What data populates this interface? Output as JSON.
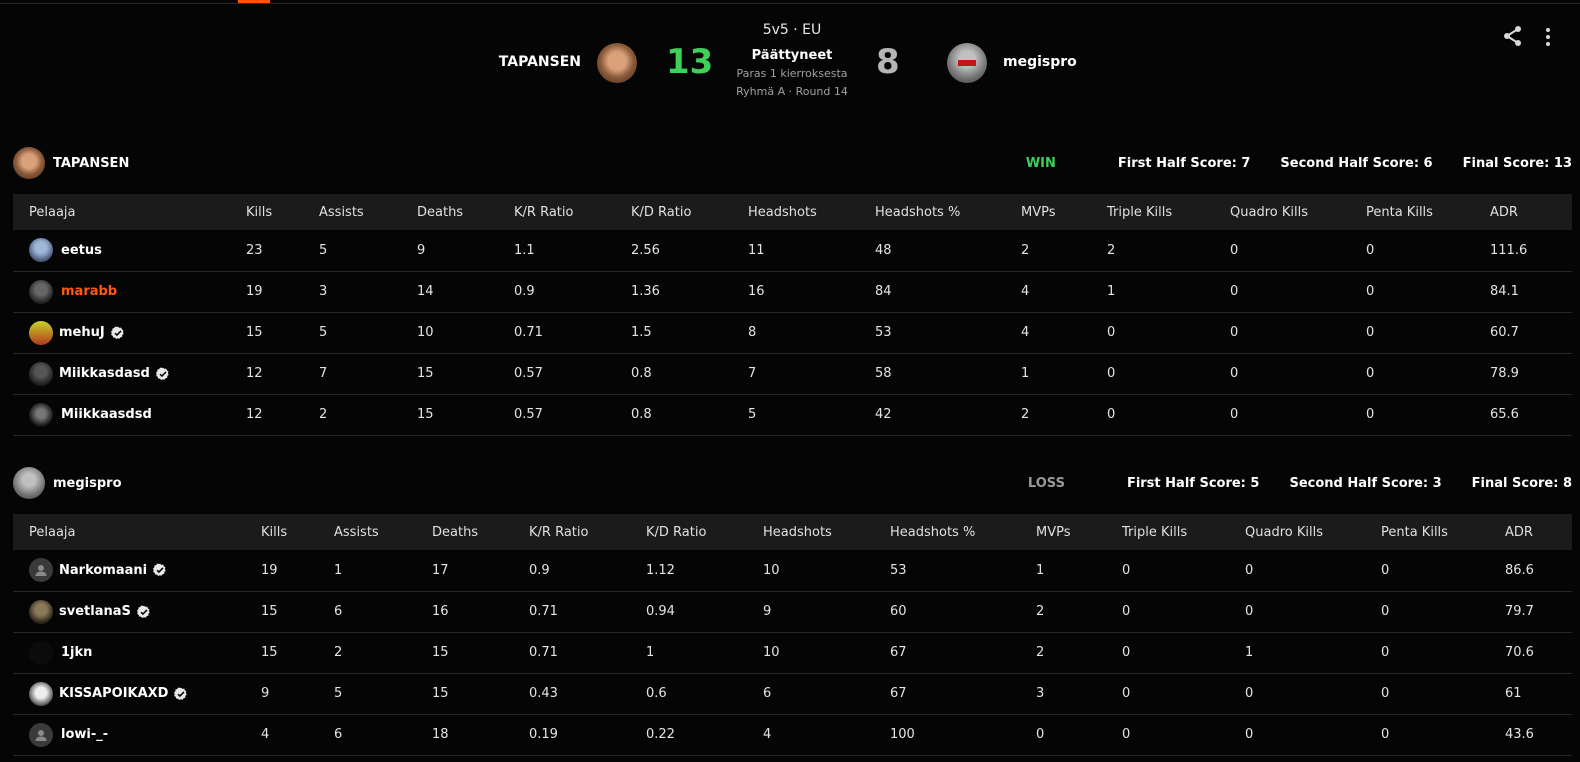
{
  "match": {
    "mode": "5v5 · EU",
    "status": "Päättyneet",
    "format": "Paras 1 kierroksesta",
    "group": "Ryhmä A · Round 14",
    "team_a": {
      "name": "TAPANSEN",
      "score": "13"
    },
    "team_b": {
      "name": "megispro",
      "score": "8"
    }
  },
  "columns": [
    "Pelaaja",
    "Kills",
    "Assists",
    "Deaths",
    "K/R Ratio",
    "K/D Ratio",
    "Headshots",
    "Headshots %",
    "MVPs",
    "Triple Kills",
    "Quadro Kills",
    "Penta Kills",
    "ADR"
  ],
  "teams": [
    {
      "name": "TAPANSEN",
      "result": "WIN",
      "first_half": "First Half Score: 7",
      "second_half": "Second Half Score: 6",
      "final": "Final Score: 13",
      "players": [
        {
          "name": "eetus",
          "verified": false,
          "highlight": false,
          "stats": [
            "23",
            "5",
            "9",
            "1.1",
            "2.56",
            "11",
            "48",
            "2",
            "2",
            "0",
            "0",
            "111.6"
          ]
        },
        {
          "name": "marabb",
          "verified": false,
          "highlight": true,
          "stats": [
            "19",
            "3",
            "14",
            "0.9",
            "1.36",
            "16",
            "84",
            "4",
            "1",
            "0",
            "0",
            "84.1"
          ]
        },
        {
          "name": "mehuJ",
          "verified": true,
          "highlight": false,
          "stats": [
            "15",
            "5",
            "10",
            "0.71",
            "1.5",
            "8",
            "53",
            "4",
            "0",
            "0",
            "0",
            "60.7"
          ]
        },
        {
          "name": "Miikkasdasd",
          "verified": true,
          "highlight": false,
          "stats": [
            "12",
            "7",
            "15",
            "0.57",
            "0.8",
            "7",
            "58",
            "1",
            "0",
            "0",
            "0",
            "78.9"
          ]
        },
        {
          "name": "Miikkaasdsd",
          "verified": false,
          "highlight": false,
          "stats": [
            "12",
            "2",
            "15",
            "0.57",
            "0.8",
            "5",
            "42",
            "2",
            "0",
            "0",
            "0",
            "65.6"
          ]
        }
      ]
    },
    {
      "name": "megispro",
      "result": "LOSS",
      "first_half": "First Half Score: 5",
      "second_half": "Second Half Score: 3",
      "final": "Final Score: 8",
      "players": [
        {
          "name": "Narkomaani",
          "verified": true,
          "highlight": false,
          "stats": [
            "19",
            "1",
            "17",
            "0.9",
            "1.12",
            "10",
            "53",
            "1",
            "0",
            "0",
            "0",
            "86.6"
          ]
        },
        {
          "name": "svetlanaS",
          "verified": true,
          "highlight": false,
          "stats": [
            "15",
            "6",
            "16",
            "0.71",
            "0.94",
            "9",
            "60",
            "2",
            "0",
            "0",
            "0",
            "79.7"
          ]
        },
        {
          "name": "1jkn",
          "verified": false,
          "highlight": false,
          "stats": [
            "15",
            "2",
            "15",
            "0.71",
            "1",
            "10",
            "67",
            "2",
            "0",
            "1",
            "0",
            "70.6"
          ]
        },
        {
          "name": "KISSAPOIKAXD",
          "verified": true,
          "highlight": false,
          "stats": [
            "9",
            "5",
            "15",
            "0.43",
            "0.6",
            "6",
            "67",
            "3",
            "0",
            "0",
            "0",
            "61"
          ]
        },
        {
          "name": "lowi-_-",
          "verified": false,
          "highlight": false,
          "stats": [
            "4",
            "6",
            "18",
            "0.19",
            "0.22",
            "4",
            "100",
            "0",
            "0",
            "0",
            "0",
            "43.6"
          ]
        }
      ]
    }
  ],
  "icons": {
    "share": "share-icon",
    "more": "more-vertical-icon",
    "verified": "verified-badge-icon"
  },
  "colors": {
    "win": "#3dd15a",
    "loss": "#9a9a9a",
    "accent": "#ff5500",
    "highlight_player": "#ff5a14"
  }
}
